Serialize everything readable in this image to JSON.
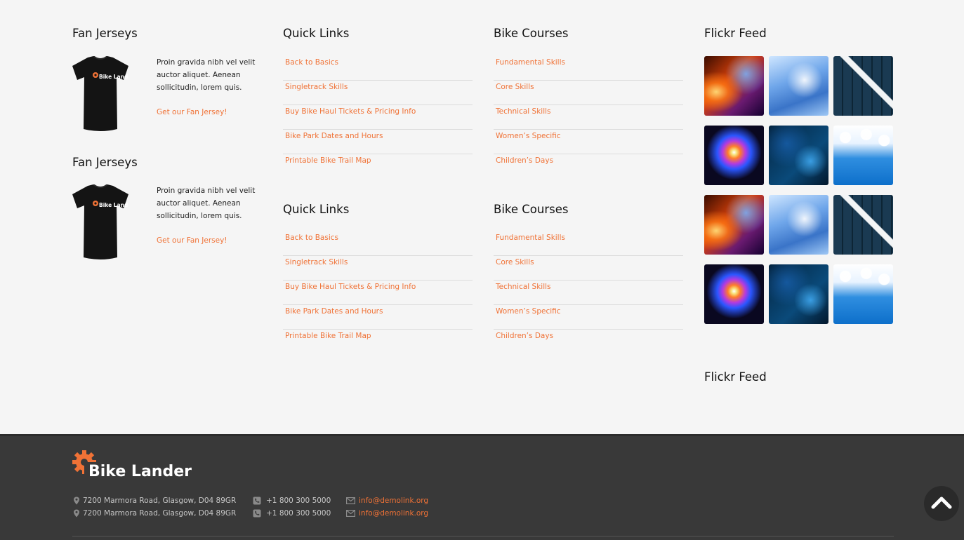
{
  "widgets": {
    "jerseys": [
      {
        "title": "Fan Jerseys",
        "text": "Proin gravida nibh vel velit auctor aliquet. Aenean sollicitudin, lorem quis.",
        "link": "Get our Fan Jersey!",
        "shirt_logo": "Bike Lander"
      },
      {
        "title": "Fan Jerseys",
        "text": "Proin gravida nibh vel velit auctor aliquet. Aenean sollicitudin, lorem quis.",
        "link": "Get our Fan Jersey!",
        "shirt_logo": "Bike Lander"
      }
    ],
    "quick_links": [
      {
        "title": "Quick Links",
        "items": [
          "Back to Basics",
          "Singletrack Skills",
          "Buy Bike Haul Tickets & Pricing Info",
          "Bike Park Dates and Hours",
          "Printable Bike Trail Map"
        ]
      },
      {
        "title": "Quick Links",
        "items": [
          "Back to Basics",
          "Singletrack Skills",
          "Buy Bike Haul Tickets & Pricing Info",
          "Bike Park Dates and Hours",
          "Printable Bike Trail Map"
        ]
      }
    ],
    "bike_courses": [
      {
        "title": "Bike Courses",
        "items": [
          "Fundamental Skills",
          "Core Skills",
          "Technical Skills",
          "Women’s Specific",
          "Children’s Days"
        ]
      },
      {
        "title": "Bike Courses",
        "items": [
          "Fundamental Skills",
          "Core Skills",
          "Technical Skills",
          "Women’s Specific",
          "Children’s Days"
        ]
      }
    ],
    "flickr": [
      {
        "title": "Flickr Feed",
        "thumbnails": [
          "abstract-fire-swirl",
          "blue-waves",
          "3d-arrow-cubes",
          "light-burst",
          "blue-fractal",
          "snowflakes",
          "abstract-fire-swirl",
          "blue-waves",
          "3d-arrow-cubes",
          "light-burst",
          "blue-fractal",
          "snowflakes"
        ]
      },
      {
        "title": "Flickr Feed"
      }
    ]
  },
  "footer": {
    "brand": "Bike Lander",
    "contacts": [
      {
        "address": "7200 Marmora Road, Glasgow, D04 89GR",
        "phone": "+1 800 300 5000",
        "email": "info@demolink.org"
      },
      {
        "address": "7200 Marmora Road, Glasgow, D04 89GR",
        "phone": "+1 800 300 5000",
        "email": "info@demolink.org"
      }
    ]
  },
  "colors": {
    "accent": "#f07236",
    "page_bg": "#f5f5f5",
    "footer_bg": "#393939"
  },
  "icons": {
    "back_to_top": "chevron-up-icon",
    "address": "map-marker-icon",
    "phone": "phone-icon",
    "email": "envelope-icon",
    "brand": "gear-icon"
  }
}
